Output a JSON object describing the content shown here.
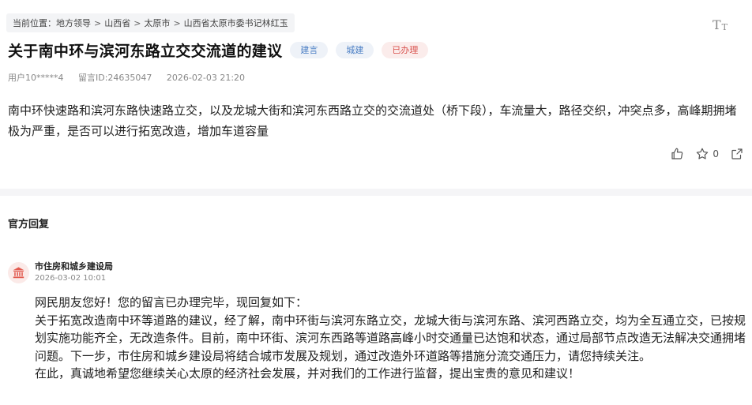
{
  "breadcrumb": {
    "prefix": "当前位置：",
    "items": [
      "地方领导",
      "山西省",
      "太原市",
      "山西省太原市委书记林红玉"
    ],
    "separator": ">"
  },
  "font_toggle": {
    "big": "T",
    "small": "T"
  },
  "post": {
    "title": "关于南中环与滨河东路立交交流道的建议",
    "tags": [
      "建言",
      "城建",
      "已办理"
    ],
    "user": "用户10*****4",
    "message_id": "留言ID:24635047",
    "time": "2026-02-03 21:20",
    "content": "南中环快速路和滨河东路快速路立交，以及龙城大街和滨河东西路立交的交流道处（桥下段），车流量大，路径交织，冲突点多，高峰期拥堵极为严重，是否可以进行拓宽改造，增加车道容量",
    "favorite_count": "0"
  },
  "reply_section": {
    "title": "官方回复",
    "author": "市住房和城乡建设局",
    "time": "2026-03-02 10:01",
    "paragraphs": [
      "网民朋友您好！您的留言已办理完毕，现回复如下：",
      "关于拓宽改造南中环等道路的建议，经了解，南中环街与滨河东路立交，龙城大街与滨河东路、滨河西路立交，均为全互通立交，已按规划实施功能齐全，无改造条件。目前，南中环街、滨河东西路等道路高峰小时交通量已达饱和状态，通过局部节点改造无法解决交通拥堵问题。下一步，市住房和城乡建设局将结合城市发展及规划，通过改造外环道路等措施分流交通压力，请您持续关注。",
      "在此，真诚地希望您继续关心太原的经济社会发展，并对我们的工作进行监督，提出宝贵的意见和建议！"
    ]
  },
  "colors": {
    "tag_blue_text": "#4a7ec4",
    "tag_blue_bg": "#eef2f8",
    "tag_red_text": "#d9534f",
    "tag_red_bg": "#fbeceb",
    "avatar_bg": "#fbeae8",
    "avatar_icon": "#e25b50"
  }
}
